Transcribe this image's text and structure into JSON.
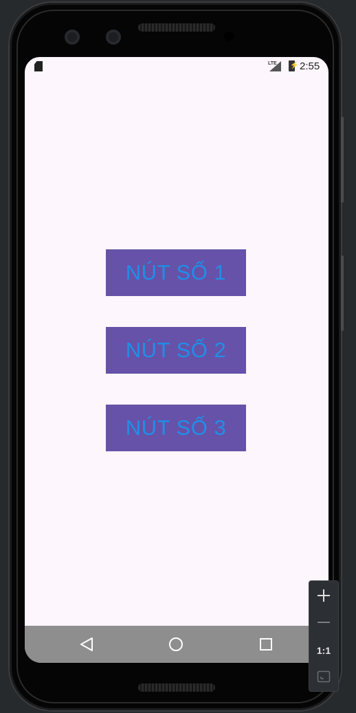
{
  "status_bar": {
    "time": "2:55",
    "network": "LTE"
  },
  "buttons": [
    {
      "label": "NÚT SỐ 1"
    },
    {
      "label": "NÚT SỐ 2"
    },
    {
      "label": "NÚT SỐ 3"
    }
  ],
  "colors": {
    "button_background": "#6652a8",
    "button_text": "#1f8fe8",
    "screen_background": "#fdf6fd",
    "nav_bar": "#8e8e8e"
  },
  "navigation": {
    "back_icon": "back-triangle-icon",
    "home_icon": "home-circle-icon",
    "recents_icon": "recents-square-icon"
  },
  "emulator_controls": {
    "zoom_in_icon": "plus-icon",
    "zoom_out_icon": "minus-icon",
    "actual_size_label": "1:1",
    "fit_icon": "fit-screen-icon"
  }
}
